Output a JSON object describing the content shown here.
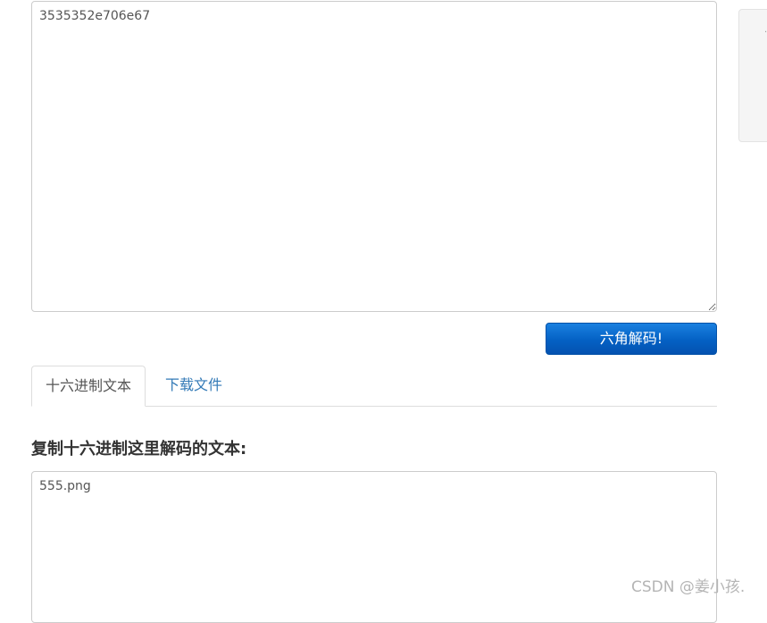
{
  "input": {
    "value": "3535352e706e67"
  },
  "decode_button": {
    "label": "六角解码!"
  },
  "tabs": [
    {
      "label": "十六进制文本",
      "active": true
    },
    {
      "label": "下载文件",
      "active": false
    }
  ],
  "output_section": {
    "title": "复制十六进制这里解码的文本:",
    "value": "555.png"
  },
  "side_panel": {
    "mark": "·"
  },
  "watermark": {
    "text": "CSDN @姜小孩."
  },
  "colors": {
    "button_primary": "#0461c4",
    "tab_link": "#337ab7",
    "border": "#cccccc"
  }
}
